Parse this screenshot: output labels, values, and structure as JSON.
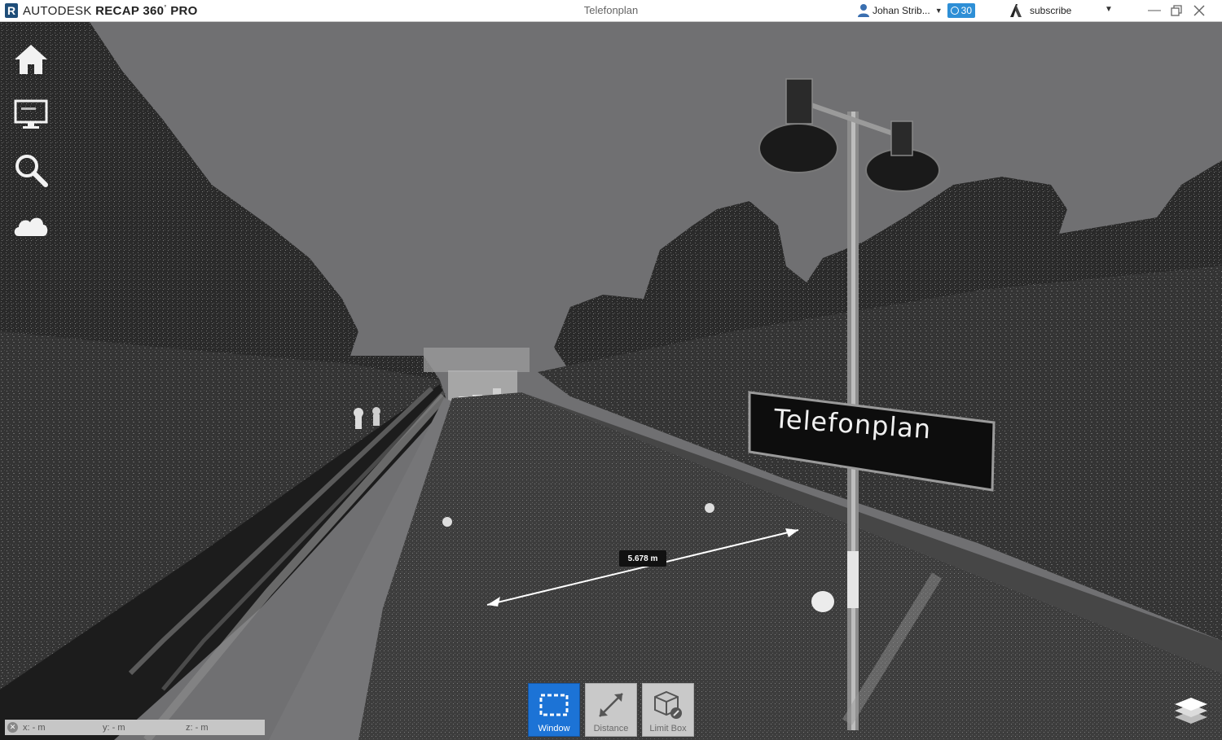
{
  "app": {
    "logo_letter": "R",
    "name_prefix": "AUTODESK",
    "name_product": "RECAP 360",
    "name_suffix": "PRO"
  },
  "document": {
    "title": "Telefonplan"
  },
  "user": {
    "name": "Johan Strib...",
    "badge_count": "30"
  },
  "subscribe": {
    "label": "subscribe"
  },
  "left_nav": [
    {
      "name": "home",
      "icon": "home-icon"
    },
    {
      "name": "display",
      "icon": "monitor-icon"
    },
    {
      "name": "search",
      "icon": "magnifier-icon"
    },
    {
      "name": "cloud",
      "icon": "cloud-icon"
    }
  ],
  "scene": {
    "sign_text": "Telefonplan",
    "measurement": "5.678 m"
  },
  "tools": [
    {
      "label": "Window",
      "icon": "selection-window-icon",
      "active": true
    },
    {
      "label": "Distance",
      "icon": "distance-measure-icon",
      "active": false
    },
    {
      "label": "Limit Box",
      "icon": "limit-box-icon",
      "active": false
    }
  ],
  "coordinates": {
    "x": "x: - m",
    "y": "y: - m",
    "z": "z: - m"
  },
  "colors": {
    "active_tool": "#1c73d6",
    "badge": "#2e8fd6",
    "sky": "#6f6f71"
  }
}
